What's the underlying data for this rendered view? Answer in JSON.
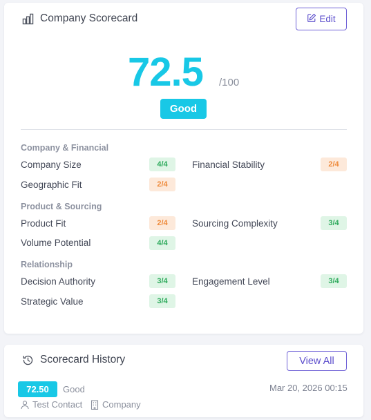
{
  "scorecard": {
    "title": "Company Scorecard",
    "title_icon": "bar-chart-icon",
    "edit_label": "Edit",
    "edit_icon": "edit-icon",
    "score": "72.5",
    "score_max": "/100",
    "rating": "Good",
    "accent_color": "#18c8e6",
    "sections": [
      {
        "title": "Company & Financial",
        "metrics": [
          {
            "label": "Company Size",
            "value": "4/4",
            "status": "green"
          },
          {
            "label": "Financial Stability",
            "value": "2/4",
            "status": "orange"
          },
          {
            "label": "Geographic Fit",
            "value": "2/4",
            "status": "orange"
          }
        ]
      },
      {
        "title": "Product & Sourcing",
        "metrics": [
          {
            "label": "Product Fit",
            "value": "2/4",
            "status": "orange"
          },
          {
            "label": "Sourcing Complexity",
            "value": "3/4",
            "status": "green"
          },
          {
            "label": "Volume Potential",
            "value": "4/4",
            "status": "green"
          }
        ]
      },
      {
        "title": "Relationship",
        "metrics": [
          {
            "label": "Decision Authority",
            "value": "3/4",
            "status": "green"
          },
          {
            "label": "Engagement Level",
            "value": "3/4",
            "status": "green"
          },
          {
            "label": "Strategic Value",
            "value": "3/4",
            "status": "green"
          }
        ]
      }
    ]
  },
  "history": {
    "title": "Scorecard History",
    "title_icon": "history-icon",
    "view_all_label": "View All",
    "entries": [
      {
        "score": "72.50",
        "rating": "Good",
        "date": "Mar 20, 2026 00:15",
        "contact": "Test Contact",
        "contact_icon": "user-icon",
        "entity": "Company",
        "entity_icon": "building-icon"
      }
    ]
  }
}
